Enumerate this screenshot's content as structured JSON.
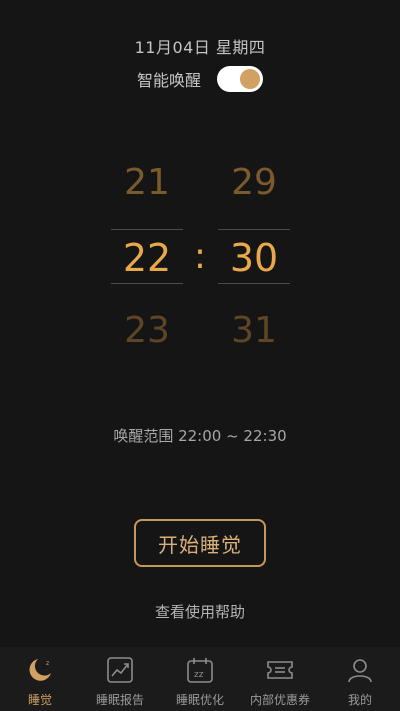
{
  "header": {
    "date": "11月04日 星期四",
    "smart_wake_label": "智能唤醒",
    "smart_wake_on": true
  },
  "picker": {
    "hours": {
      "above": "21",
      "selected": "22",
      "below": "23"
    },
    "minutes": {
      "above": "29",
      "selected": "30",
      "below": "31"
    },
    "separator": ":"
  },
  "wake_range": "唤醒范围 22:00 ~ 22:30",
  "start_button": "开始睡觉",
  "help_link": "查看使用帮助",
  "tabs": [
    {
      "label": "睡觉",
      "icon": "moon-sleep-icon",
      "active": true
    },
    {
      "label": "睡眠报告",
      "icon": "chart-report-icon",
      "active": false
    },
    {
      "label": "睡眠优化",
      "icon": "calendar-sleep-icon",
      "active": false
    },
    {
      "label": "内部优惠券",
      "icon": "coupon-icon",
      "active": false
    },
    {
      "label": "我的",
      "icon": "user-icon",
      "active": false
    }
  ],
  "colors": {
    "background": "#151515",
    "accent": "#d1a062",
    "selected_digit": "#e9a94b"
  }
}
